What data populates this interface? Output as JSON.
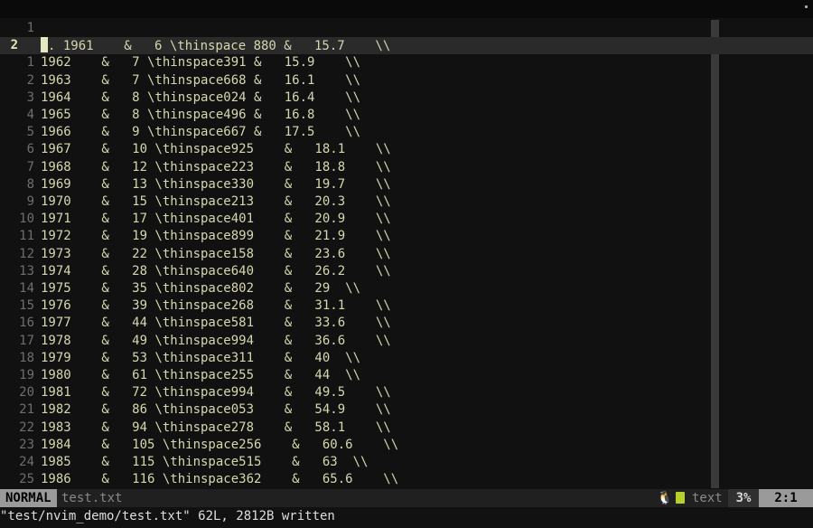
{
  "editor": {
    "lines": [
      {
        "num": "1",
        "text": ""
      },
      {
        "num": "2",
        "text": ". 1961    &   6 \\thinspace 880 &   15.7    \\\\",
        "current": true
      },
      {
        "num": "1",
        "text": "1962    &   7 \\thinspace391 &   15.9    \\\\"
      },
      {
        "num": "2",
        "text": "1963    &   7 \\thinspace668 &   16.1    \\\\"
      },
      {
        "num": "3",
        "text": "1964    &   8 \\thinspace024 &   16.4    \\\\"
      },
      {
        "num": "4",
        "text": "1965    &   8 \\thinspace496 &   16.8    \\\\"
      },
      {
        "num": "5",
        "text": "1966    &   9 \\thinspace667 &   17.5    \\\\"
      },
      {
        "num": "6",
        "text": "1967    &   10 \\thinspace925    &   18.1    \\\\"
      },
      {
        "num": "7",
        "text": "1968    &   12 \\thinspace223    &   18.8    \\\\"
      },
      {
        "num": "8",
        "text": "1969    &   13 \\thinspace330    &   19.7    \\\\"
      },
      {
        "num": "9",
        "text": "1970    &   15 \\thinspace213    &   20.3    \\\\"
      },
      {
        "num": "10",
        "text": "1971    &   17 \\thinspace401    &   20.9    \\\\"
      },
      {
        "num": "11",
        "text": "1972    &   19 \\thinspace899    &   21.9    \\\\"
      },
      {
        "num": "12",
        "text": "1973    &   22 \\thinspace158    &   23.6    \\\\"
      },
      {
        "num": "13",
        "text": "1974    &   28 \\thinspace640    &   26.2    \\\\"
      },
      {
        "num": "14",
        "text": "1975    &   35 \\thinspace802    &   29  \\\\"
      },
      {
        "num": "15",
        "text": "1976    &   39 \\thinspace268    &   31.1    \\\\"
      },
      {
        "num": "16",
        "text": "1977    &   44 \\thinspace581    &   33.6    \\\\"
      },
      {
        "num": "17",
        "text": "1978    &   49 \\thinspace994    &   36.6    \\\\"
      },
      {
        "num": "18",
        "text": "1979    &   53 \\thinspace311    &   40  \\\\"
      },
      {
        "num": "19",
        "text": "1980    &   61 \\thinspace255    &   44  \\\\"
      },
      {
        "num": "20",
        "text": "1981    &   72 \\thinspace994    &   49.5    \\\\"
      },
      {
        "num": "21",
        "text": "1982    &   86 \\thinspace053    &   54.9    \\\\"
      },
      {
        "num": "22",
        "text": "1983    &   94 \\thinspace278    &   58.1    \\\\"
      },
      {
        "num": "23",
        "text": "1984    &   105 \\thinspace256    &   60.6    \\\\"
      },
      {
        "num": "24",
        "text": "1985    &   115 \\thinspace515    &   63  \\\\"
      },
      {
        "num": "25",
        "text": "1986    &   116 \\thinspace362    &   65.6    \\\\"
      }
    ]
  },
  "statusline": {
    "mode": "NORMAL",
    "filename": "test.txt",
    "os_icon": "linux-icon",
    "filetype_icon": "file-icon",
    "filetype": "text",
    "percent": "3%",
    "position": "2:1"
  },
  "cmdline": {
    "message": "\"test/nvim_demo/test.txt\" 62L, 2812B written"
  },
  "colors": {
    "background": "#111111",
    "current_line": "#2a2a2a",
    "text": "#d7d7af",
    "line_number": "#6e6e6e",
    "mode_bg": "#9a9a9a",
    "filetype_icon": "#b8cf30"
  }
}
